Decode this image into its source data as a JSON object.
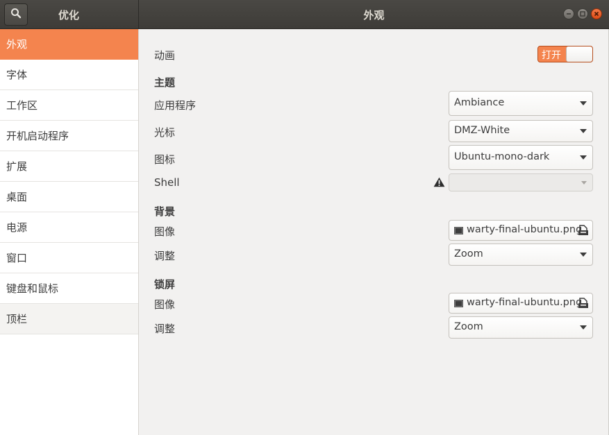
{
  "header": {
    "left_title": "优化",
    "main_title": "外观"
  },
  "sidebar": {
    "items": [
      {
        "label": "外观"
      },
      {
        "label": "字体"
      },
      {
        "label": "工作区"
      },
      {
        "label": "开机启动程序"
      },
      {
        "label": "扩展"
      },
      {
        "label": "桌面"
      },
      {
        "label": "电源"
      },
      {
        "label": "窗口"
      },
      {
        "label": "键盘和鼠标"
      },
      {
        "label": "顶栏"
      }
    ],
    "selected_index": 0
  },
  "content": {
    "animation": {
      "label": "动画",
      "switch_text": "打开",
      "enabled": true
    },
    "themes": {
      "heading": "主题",
      "applications": {
        "label": "应用程序",
        "value": "Ambiance"
      },
      "cursor": {
        "label": "光标",
        "value": "DMZ-White"
      },
      "icons": {
        "label": "图标",
        "value": "Ubuntu-mono-dark"
      },
      "shell": {
        "label": "Shell",
        "value": ""
      }
    },
    "background": {
      "heading": "背景",
      "image": {
        "label": "图像",
        "value": "warty-final-ubuntu.png"
      },
      "adjust": {
        "label": "调整",
        "value": "Zoom"
      }
    },
    "lockscreen": {
      "heading": "锁屏",
      "image": {
        "label": "图像",
        "value": "warty-final-ubuntu.png"
      },
      "adjust": {
        "label": "调整",
        "value": "Zoom"
      }
    }
  },
  "colors": {
    "accent": "#f4844e",
    "headerbar": "#3e3c38",
    "close_button": "#df4b16"
  }
}
